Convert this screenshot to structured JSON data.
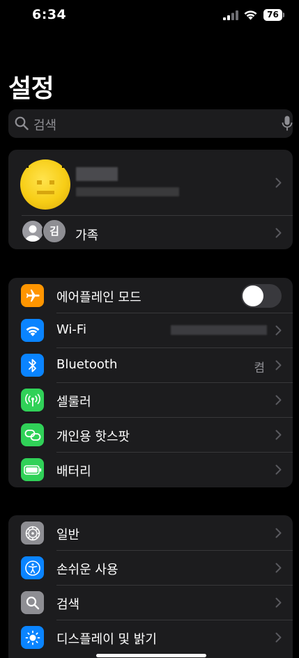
{
  "status_bar": {
    "time": "6:34",
    "battery": "76"
  },
  "header": {
    "title": "설정"
  },
  "search": {
    "placeholder": "검색"
  },
  "profile": {
    "name": "",
    "family_label": "가족",
    "family_initial": "김"
  },
  "connectivity": [
    {
      "id": "airplane",
      "label": "에어플레인 모드",
      "value": "",
      "icon": "airplane-icon",
      "color": "#ff9500",
      "toggle": false
    },
    {
      "id": "wifi",
      "label": "Wi-Fi",
      "value": "",
      "icon": "wifi-icon",
      "color": "#0a84ff"
    },
    {
      "id": "bluetooth",
      "label": "Bluetooth",
      "value": "켬",
      "icon": "bluetooth-icon",
      "color": "#0a84ff"
    },
    {
      "id": "cellular",
      "label": "셀룰러",
      "value": "",
      "icon": "antenna-icon",
      "color": "#30d158"
    },
    {
      "id": "hotspot",
      "label": "개인용 핫스팟",
      "value": "",
      "icon": "link-icon",
      "color": "#30d158"
    },
    {
      "id": "battery",
      "label": "배터리",
      "value": "",
      "icon": "battery-icon",
      "color": "#30d158"
    }
  ],
  "general": [
    {
      "id": "general",
      "label": "일반",
      "icon": "gear-icon",
      "color": "#8e8e93"
    },
    {
      "id": "accessibility",
      "label": "손쉬운 사용",
      "icon": "accessibility-icon",
      "color": "#0a84ff"
    },
    {
      "id": "search",
      "label": "검색",
      "icon": "search-icon",
      "color": "#8e8e93"
    },
    {
      "id": "display",
      "label": "디스플레이 및 밝기",
      "icon": "sun-icon",
      "color": "#0a84ff"
    }
  ]
}
